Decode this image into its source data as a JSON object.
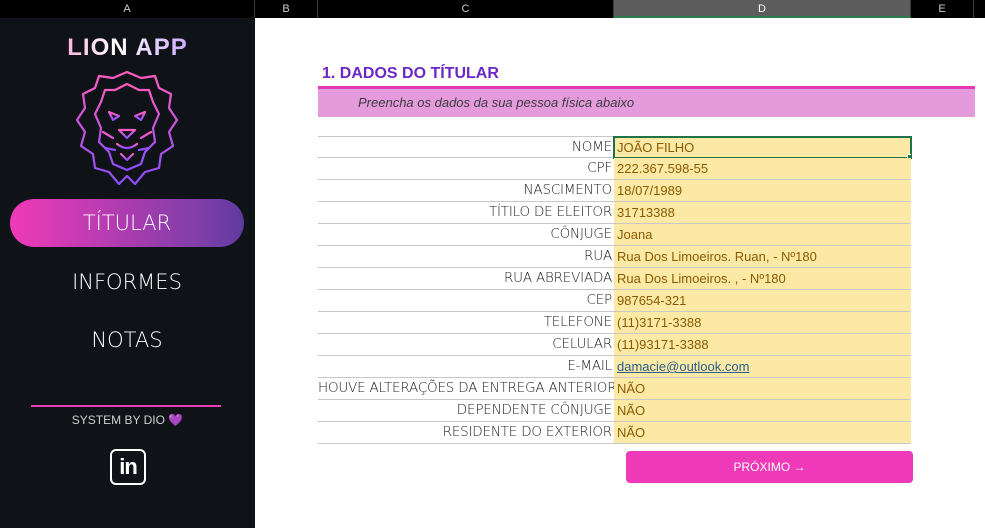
{
  "columns": [
    "A",
    "B",
    "C",
    "D",
    "E"
  ],
  "app": {
    "title": "LION APP"
  },
  "nav": [
    {
      "label": "TÍTULAR",
      "active": true
    },
    {
      "label": "INFORMES",
      "active": false
    },
    {
      "label": "NOTAS",
      "active": false
    }
  ],
  "footer": {
    "system_text": "SYSTEM BY DIO",
    "heart": "💜",
    "linkedin_label": "in"
  },
  "section": {
    "title": "1. DADOS DO TÍTULAR",
    "subtitle": "Preencha os dados da sua pessoa física abaixo"
  },
  "form": {
    "rows": [
      {
        "label": "NOME",
        "value": "JOÃO FILHO"
      },
      {
        "label": "CPF",
        "value": "222.367.598-55"
      },
      {
        "label": "NASCIMENTO",
        "value": "18/07/1989"
      },
      {
        "label": "TÍTILO DE ELEITOR",
        "value": "31713388"
      },
      {
        "label": "CÔNJUGE",
        "value": "Joana"
      },
      {
        "label": "RUA",
        "value": " Rua Dos Limoeiros. Ruan, - Nº180"
      },
      {
        "label": "RUA ABREVIADA",
        "value": " Rua Dos Limoeiros. , - Nº180"
      },
      {
        "label": "CEP",
        "value": "987654-321"
      },
      {
        "label": "TELEFONE",
        "value": "(11)3171-3388"
      },
      {
        "label": "CELULAR",
        "value": "(11)93171-3388"
      },
      {
        "label": "E-MAIL",
        "value": "damacie@outlook.com"
      },
      {
        "label": "HOUVE ALTERAÇÕES DA ENTREGA ANTERIOR",
        "value": "NÃO"
      },
      {
        "label": "DEPENDENTE CÔNJUGE",
        "value": "NÃO"
      },
      {
        "label": "RESIDENTE DO EXTERIOR",
        "value": "NÃO"
      }
    ]
  },
  "next_button": {
    "label": "PRÓXIMO →"
  },
  "colors": {
    "sidebar_bg": "#0f1217",
    "accent_pink": "#ee3ab9",
    "accent_purple": "#6b28c4",
    "input_fill": "#fde9a6",
    "subtitle_bar": "#e49bdc"
  }
}
